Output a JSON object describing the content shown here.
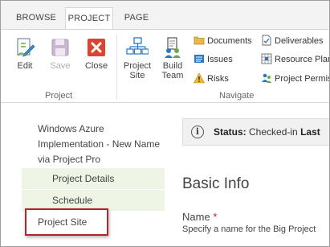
{
  "tabs": [
    {
      "label": "BROWSE"
    },
    {
      "label": "PROJECT"
    },
    {
      "label": "PAGE"
    }
  ],
  "ribbon": {
    "project_group": {
      "label": "Project",
      "buttons": [
        {
          "label": "Edit",
          "icon": "edit-icon"
        },
        {
          "label": "Save",
          "icon": "save-icon"
        },
        {
          "label": "Close",
          "icon": "close-icon"
        }
      ]
    },
    "navigate_group": {
      "label": "Navigate",
      "large_buttons": [
        {
          "label1": "Project",
          "label2": "Site",
          "icon": "project-site-icon"
        },
        {
          "label1": "Build",
          "label2": "Team",
          "icon": "build-team-icon"
        }
      ],
      "small_buttons": [
        {
          "label": "Documents",
          "icon": "documents-icon"
        },
        {
          "label": "Issues",
          "icon": "issues-icon"
        },
        {
          "label": "Risks",
          "icon": "risks-icon"
        },
        {
          "label": "Deliverables",
          "icon": "deliverables-icon"
        },
        {
          "label": "Resource Plan",
          "icon": "resource-plan-icon"
        },
        {
          "label": "Project Permis",
          "icon": "project-permissions-icon"
        }
      ]
    }
  },
  "leftnav": {
    "project_title": "Windows Azure Implementation - New Name via Project Pro",
    "items": [
      {
        "label": "Project Details"
      },
      {
        "label": "Schedule"
      },
      {
        "label": "Project Site"
      }
    ]
  },
  "status": {
    "label": "Status:",
    "text": "Checked-in",
    "trailing": "Last"
  },
  "main": {
    "section_title": "Basic Info",
    "name_label": "Name",
    "required_marker": "*",
    "name_hint": "Specify a name for the Big Project"
  },
  "colors": {
    "accent_red": "#b3242c",
    "nav_green": "#eef5e4"
  }
}
